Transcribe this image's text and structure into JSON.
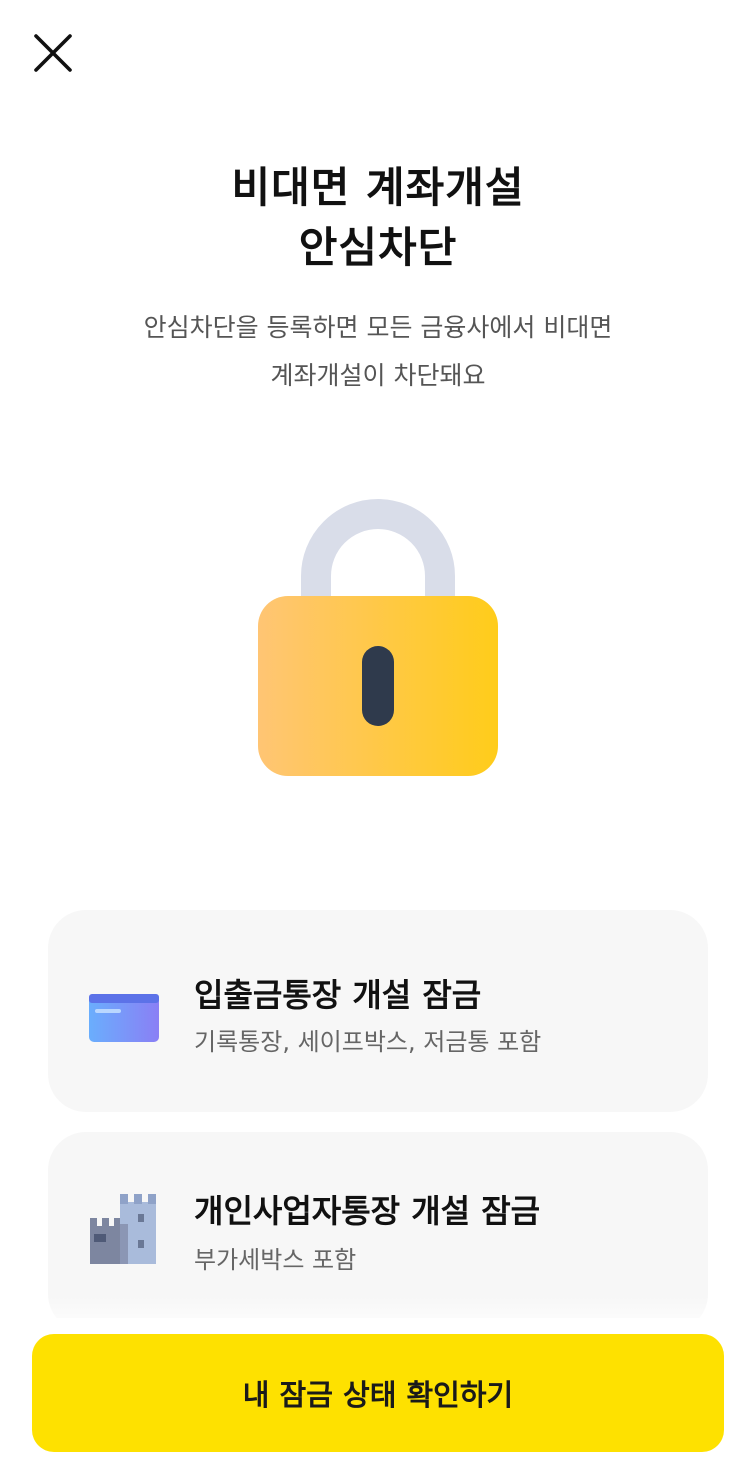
{
  "header": {
    "close_icon": "close-icon"
  },
  "hero": {
    "title_line1": "비대면 계좌개설",
    "title_line2": "안심차단",
    "desc_line1": "안심차단을 등록하면 모든 금융사에서 비대면",
    "desc_line2": "계좌개설이 차단돼요",
    "illustration": "padlock-icon",
    "colors": {
      "lock_body_start": "#ffc574",
      "lock_body_end": "#ffcc1a",
      "shackle": "#d9dde9",
      "keyhole": "#2f3a4c"
    }
  },
  "options": [
    {
      "icon": "bankbook-card-icon",
      "title": "입출금통장 개설 잠금",
      "desc": "기록통장, 세이프박스, 저금통 포함"
    },
    {
      "icon": "building-icon",
      "title": "개인사업자통장 개설 잠금",
      "desc": "부가세박스 포함"
    }
  ],
  "cta": {
    "label": "내 잠금 상태 확인하기",
    "color": "#fee100"
  }
}
